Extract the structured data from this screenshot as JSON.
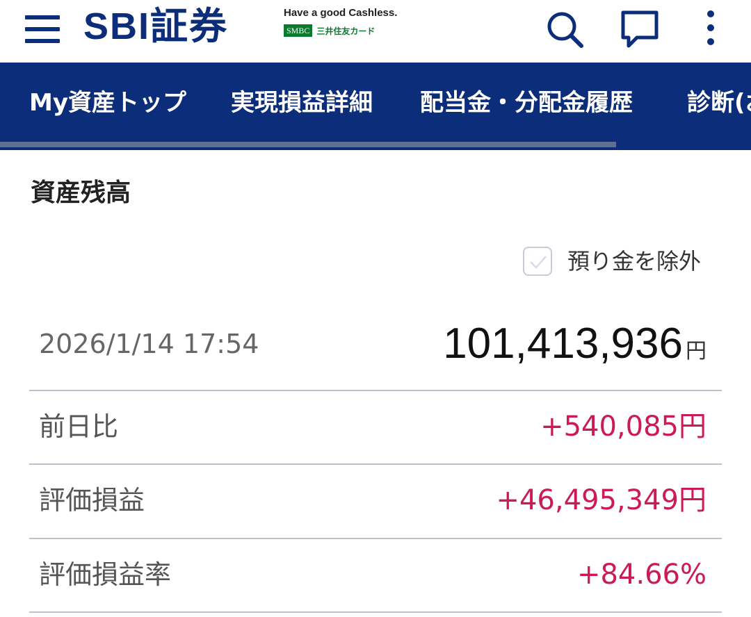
{
  "header": {
    "brand": "SBI証券",
    "tagline": "Have a good Cashless.",
    "card_badge": "SMBC",
    "card_name": "三井住友カード",
    "icons": [
      "menu-icon",
      "search-icon",
      "chat-icon",
      "more-vertical-icon"
    ]
  },
  "tabs": [
    {
      "label": "My資産トップ"
    },
    {
      "label": "実現損益詳細"
    },
    {
      "label": "配当金・分配金履歴"
    },
    {
      "label": "診断(お"
    }
  ],
  "section": {
    "title": "資産残高",
    "exclude_deposit_label": "預り金を除外",
    "exclude_deposit_checked": false
  },
  "balance": {
    "datetime": "2026/1/14 17:54",
    "total": "101,413,936",
    "unit": "円"
  },
  "rows": [
    {
      "label": "前日比",
      "value": "+540,085円"
    },
    {
      "label": "評価損益",
      "value": "+46,495,349円"
    },
    {
      "label": "評価損益率",
      "value": "+84.66%"
    }
  ],
  "colors": {
    "brand_navy": "#0b2d7a",
    "positive": "#cc1a55",
    "divider": "#bcc2cc"
  }
}
